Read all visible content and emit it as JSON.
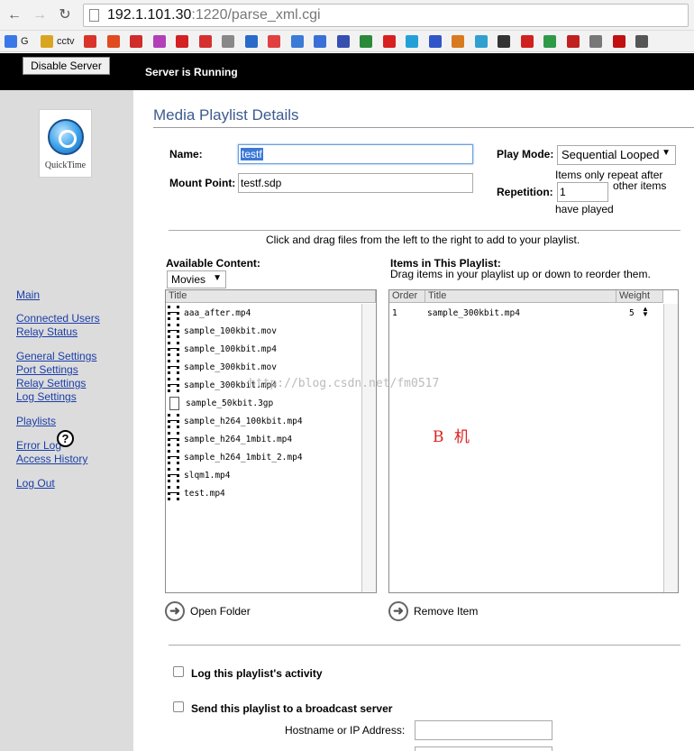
{
  "browser": {
    "url_host": "192.1.101.30",
    "url_port_path": ":1220/parse_xml.cgi",
    "bookmarks": [
      {
        "icon": "google-icon",
        "label": "G",
        "color": "#3b78e7"
      },
      {
        "icon": "folder-icon",
        "label": "cctv",
        "color": "#d9a520"
      }
    ],
    "bookmark_icon_colors": [
      "#d9332b",
      "#e04b1f",
      "#d12b2b",
      "#b23fb8",
      "#d42020",
      "#d43030",
      "#888888",
      "#2a6ac9",
      "#e04040",
      "#3a7bd5",
      "#3a6fd8",
      "#3550b0",
      "#2a8a3a",
      "#d82020",
      "#24a0d8",
      "#3056c8",
      "#d87a20",
      "#30a0d0",
      "#333333",
      "#d02020",
      "#2e9a48",
      "#c02020",
      "#777777",
      "#c01010",
      "#555555"
    ]
  },
  "header": {
    "disable_button": "Disable Server",
    "status": "Server is Running"
  },
  "sidebar": {
    "logo_text": "QuickTime",
    "links": [
      "Main",
      "Connected Users",
      "Relay Status",
      "General Settings",
      "Port Settings",
      "Relay Settings",
      "Log Settings",
      "Playlists",
      "Error Log",
      "Access History",
      "Log Out"
    ],
    "help": "?"
  },
  "main": {
    "title": "Media Playlist Details",
    "name_label": "Name:",
    "name_value": "testf",
    "mount_label": "Mount Point:",
    "mount_value": "testf.sdp",
    "play_mode_label": "Play Mode:",
    "play_mode_value": "Sequential Looped",
    "repeat_hint_1": "Items only repeat after",
    "repetition_label": "Repetition:",
    "repetition_value": "1",
    "repeat_hint_2": "other items",
    "repeat_hint_3": "have played",
    "instructions": "Click and drag files from the left to the right to add to your playlist.",
    "available_label": "Available Content:",
    "category_value": "Movies",
    "playlist_label": "Items in This Playlist:",
    "playlist_hint": "Drag items in your playlist up or down to reorder them.",
    "available_columns": [
      "Title"
    ],
    "available_items": [
      {
        "name": "aaa_after.mp4",
        "type": "film"
      },
      {
        "name": "sample_100kbit.mov",
        "type": "film"
      },
      {
        "name": "sample_100kbit.mp4",
        "type": "film"
      },
      {
        "name": "sample_300kbit.mov",
        "type": "film"
      },
      {
        "name": "sample_300kbit.mp4",
        "type": "film"
      },
      {
        "name": "sample_50kbit.3gp",
        "type": "doc"
      },
      {
        "name": "sample_h264_100kbit.mp4",
        "type": "film"
      },
      {
        "name": "sample_h264_1mbit.mp4",
        "type": "film"
      },
      {
        "name": "sample_h264_1mbit_2.mp4",
        "type": "film"
      },
      {
        "name": "slqm1.mp4",
        "type": "film"
      },
      {
        "name": "test.mp4",
        "type": "film"
      }
    ],
    "playlist_columns": {
      "order": "Order",
      "title": "Title",
      "weight": "Weight"
    },
    "playlist_items": [
      {
        "order": "1",
        "title": "sample_300kbit.mp4",
        "weight": "5"
      }
    ],
    "open_folder": "Open Folder",
    "remove_item": "Remove Item",
    "log_activity": "Log this playlist's activity",
    "broadcast": "Send this playlist to a broadcast server",
    "hostname_label": "Hostname or IP Address:",
    "watermark": "http://blog.csdn.net/fm0517",
    "annotation": "B 机"
  }
}
